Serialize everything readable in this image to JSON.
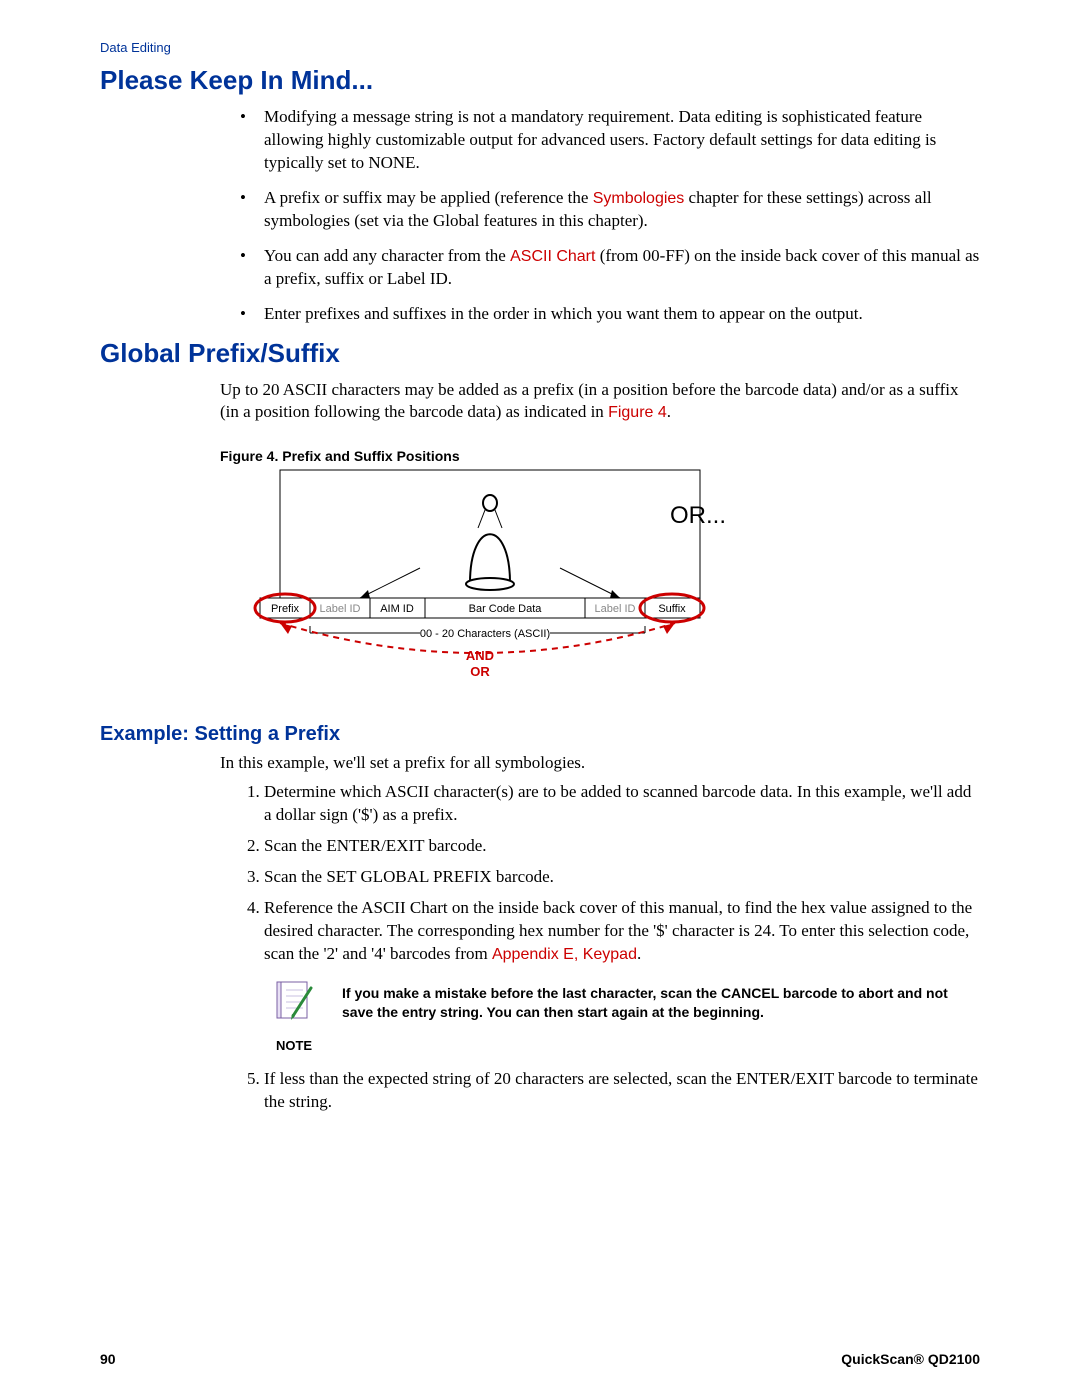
{
  "header": {
    "section": "Data Editing"
  },
  "h1": {
    "text": "Please Keep In Mind..."
  },
  "bullets": {
    "b1_a": "Modifying a message string is not a mandatory requirement. Data editing is sophisticated feature allowing highly customizable output for advanced users. Factory default settings for data editing is typically set to NONE.",
    "b2_a": "A prefix or suffix may be applied (reference the ",
    "b2_link": "Symbologies",
    "b2_b": " chapter for these settings) across all symbologies (set via the Global features in this chapter).",
    "b3_a": "You can add any character from the ",
    "b3_link": "ASCII Chart",
    "b3_b": " (from 00-FF) on the inside back cover of this manual as a prefix, suffix or Label ID.",
    "b4_a": "Enter prefixes and suffixes in the order in which you want them to appear on the output."
  },
  "h2": {
    "text": "Global Prefix/Suffix"
  },
  "gps": {
    "p1_a": "Up to 20 ASCII characters may be added as a prefix (in a position before the barcode data) and/or as a suffix (in a position following the barcode data) as indicated in ",
    "p1_link": "Figure 4",
    "p1_b": "."
  },
  "figure": {
    "caption": "Figure 4. Prefix and Suffix Positions",
    "or": "OR...",
    "cells": {
      "prefix": "Prefix",
      "label1": "Label ID",
      "aim": "AIM ID",
      "data": "Bar Code Data",
      "label2": "Label ID",
      "suffix": "Suffix"
    },
    "chars": "00 - 20 Characters (ASCII)",
    "and": "AND",
    "or2": "OR"
  },
  "h3": {
    "text": "Example: Setting a Prefix"
  },
  "example": {
    "intro": "In this example, we'll set a prefix for all symbologies.",
    "s1": "Determine which ASCII character(s) are to be added to scanned barcode data. In this example, we'll add a dollar sign ('$') as a prefix.",
    "s2": "Scan the ENTER/EXIT barcode.",
    "s3": "Scan the SET GLOBAL PREFIX barcode.",
    "s4_a": "Reference the ASCII Chart on the inside back cover of this manual, to find the hex value assigned to the desired character. The corresponding hex number for the '$' character is 24. To enter this selection code, scan the '2' and '4' barcodes from ",
    "s4_link": "Appendix E, Keypad",
    "s4_b": ".",
    "s5": "If less than the expected string of 20 characters are selected, scan the ENTER/EXIT barcode to terminate the string."
  },
  "note": {
    "label": "NOTE",
    "text": "If you make a mistake before the last character, scan the CANCEL barcode to abort and not save the entry string. You can then start again at the beginning."
  },
  "footer": {
    "page": "90",
    "product": "QuickScan® QD2100"
  }
}
